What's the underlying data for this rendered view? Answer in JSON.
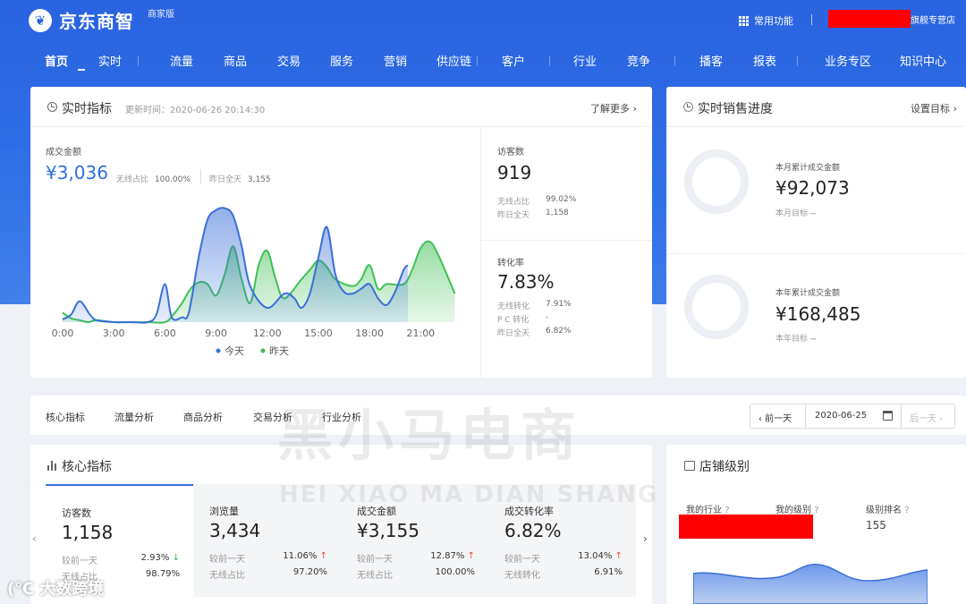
{
  "header": {
    "logo_mark": "❦",
    "app_name": "京东商智",
    "edition": "商家版",
    "common_functions": "常用功能",
    "store_suffix": "旗舰专营店"
  },
  "nav": {
    "items": [
      "首页",
      "实时",
      "流量",
      "商品",
      "交易",
      "服务",
      "营销",
      "供应链",
      "客户",
      "行业",
      "竞争",
      "播客",
      "报表",
      "业务专区",
      "知识中心"
    ],
    "active_index": 0
  },
  "realtime": {
    "title": "实时指标",
    "update_time": "更新时间：2020-06-26 20:14:30",
    "learn_more": "了解更多 ›",
    "gmv_label": "成交金额",
    "gmv_value": "¥3,036",
    "wireless_share_label": "无线占比",
    "wireless_share_value": "100.00%",
    "yesterday_label": "昨日全天",
    "yesterday_value": "3,155",
    "visitors": {
      "label": "访客数",
      "value": "919",
      "wireless_label": "无线占比",
      "wireless_value": "99.02%",
      "yesterday_label": "昨日全天",
      "yesterday_value": "1,158"
    },
    "conversion": {
      "label": "转化率",
      "value": "7.83%",
      "wireless_label": "无线转化",
      "wireless_value": "7.91%",
      "pc_label": "P C 转化",
      "pc_value": "-",
      "yesterday_label": "昨日全天",
      "yesterday_value": "6.82%"
    }
  },
  "chart_data": {
    "type": "area",
    "categories": [
      "0:00",
      "3:00",
      "6:00",
      "9:00",
      "12:00",
      "15:00",
      "18:00",
      "21:00"
    ],
    "series": [
      {
        "name": "今天",
        "color": "#3a6fd8",
        "x": [
          0,
          0.5,
          1,
          1.6,
          2,
          3,
          4,
          5,
          5.5,
          6,
          6.4,
          7,
          7.4,
          8,
          8.5,
          9,
          9.5,
          10,
          10.5,
          11,
          12,
          13,
          13.6,
          14,
          14.5,
          15,
          15.5,
          16,
          16.5,
          17,
          17.5,
          18,
          18.5,
          19,
          19.5,
          20,
          20.25
        ],
        "values": [
          3,
          8,
          22,
          8,
          2,
          0,
          0,
          0,
          8,
          40,
          5,
          5,
          10,
          70,
          108,
          118,
          120,
          112,
          80,
          38,
          15,
          30,
          25,
          15,
          30,
          68,
          100,
          50,
          32,
          30,
          35,
          40,
          25,
          18,
          32,
          55,
          60
        ]
      },
      {
        "name": "昨天",
        "color": "#40c057",
        "x": [
          0,
          0.5,
          1,
          1.5,
          2,
          3,
          4,
          5,
          6,
          6.5,
          7,
          7.5,
          8,
          8.5,
          9,
          9.5,
          10,
          10.5,
          11,
          11.5,
          12,
          12.5,
          13,
          14,
          14.5,
          15,
          15.5,
          16,
          17,
          17.5,
          18,
          18.5,
          19,
          20,
          20.5,
          21,
          21.5,
          22,
          23
        ],
        "values": [
          10,
          4,
          2,
          0,
          2,
          0,
          0,
          0,
          0,
          8,
          20,
          35,
          42,
          40,
          28,
          50,
          80,
          45,
          20,
          60,
          75,
          45,
          25,
          45,
          55,
          65,
          58,
          45,
          38,
          45,
          60,
          35,
          40,
          40,
          55,
          78,
          85,
          72,
          30
        ]
      }
    ],
    "ylim": [
      0,
      130
    ],
    "xlim": [
      0,
      23.5
    ],
    "legend": "bottom"
  },
  "sales_progress": {
    "title": "实时销售进度",
    "set_goal": "设置目标 ›",
    "month_label": "本月累计成交金额",
    "month_value": "¥92,073",
    "month_goal_label": "本月目标",
    "month_goal_value": "--",
    "year_label": "本年累计成交金额",
    "year_value": "¥168,485",
    "year_goal_label": "本年目标",
    "year_goal_value": "--"
  },
  "analysis_tabs": [
    "核心指标",
    "流量分析",
    "商品分析",
    "交易分析",
    "行业分析"
  ],
  "date_picker": {
    "prev": "‹ 前一天",
    "date": "2020-06-25",
    "next": "后一天 ›"
  },
  "core": {
    "title": "核心指标",
    "prev_arrow": "‹",
    "next_arrow": "›",
    "metrics": [
      {
        "label": "访客数",
        "value": "1,158",
        "cmp_label": "较前一天",
        "cmp_value": "2.93%",
        "dir": "↓",
        "share_label": "无线占比",
        "share_value": "98.79%"
      },
      {
        "label": "浏览量",
        "value": "3,434",
        "cmp_label": "较前一天",
        "cmp_value": "11.06%",
        "dir": "↑",
        "share_label": "无线占比",
        "share_value": "97.20%"
      },
      {
        "label": "成交金额",
        "value": "¥3,155",
        "cmp_label": "较前一天",
        "cmp_value": "12.87%",
        "dir": "↑",
        "share_label": "无线占比",
        "share_value": "100.00%"
      },
      {
        "label": "成交转化率",
        "value": "6.82%",
        "cmp_label": "较前一天",
        "cmp_value": "13.04%",
        "dir": "↑",
        "share_label": "无线转化",
        "share_value": "6.91%"
      }
    ]
  },
  "store_level": {
    "title": "店铺级别",
    "industry_label": "我的行业",
    "level_label": "我的级别",
    "rank_label": "级别排名",
    "rank_value": "155",
    "help": "?"
  },
  "watermarks": {
    "main_cn": "黑小马电商",
    "main_en": "HEI XIAO MA DIAN SHANG",
    "corner": "大数跨境",
    "corner_logo": "(℃"
  }
}
